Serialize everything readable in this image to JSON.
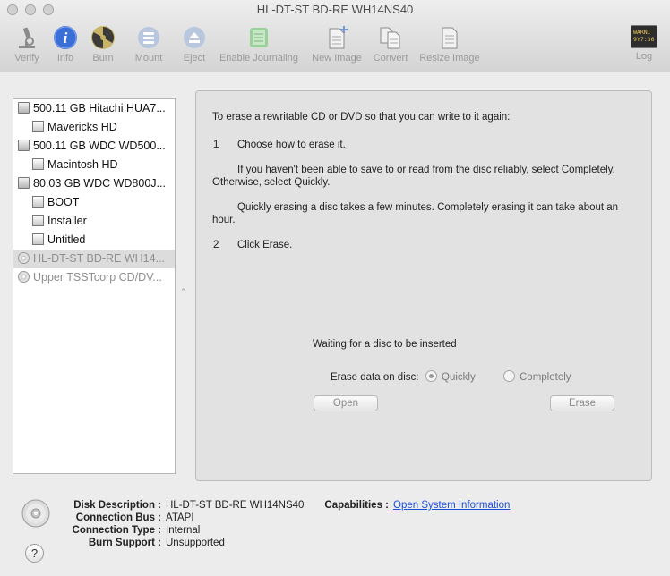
{
  "window": {
    "title": "HL-DT-ST BD-RE WH14NS40"
  },
  "toolbar": {
    "verify": "Verify",
    "info": "Info",
    "burn": "Burn",
    "mount": "Mount",
    "eject": "Eject",
    "enable_journaling": "Enable Journaling",
    "new_image": "New Image",
    "convert": "Convert",
    "resize_image": "Resize Image",
    "log": "Log",
    "log_screen_text": "WARNI\n9Y7:36"
  },
  "sidebar": {
    "items": [
      {
        "label": "500.11 GB Hitachi HUA7..."
      },
      {
        "label": "Mavericks HD"
      },
      {
        "label": "500.11 GB WDC WD500..."
      },
      {
        "label": "Macintosh HD"
      },
      {
        "label": "80.03 GB WDC WD800J..."
      },
      {
        "label": "BOOT"
      },
      {
        "label": "Installer"
      },
      {
        "label": "Untitled"
      },
      {
        "label": "HL-DT-ST BD-RE WH14..."
      },
      {
        "label": "Upper TSSTcorp CD/DV..."
      }
    ],
    "resize_glyph": "‸"
  },
  "erase": {
    "intro": "To erase a rewritable CD or DVD so that you can write to it again:",
    "step1_num": "1",
    "step1": "Choose how to erase it.",
    "para1": "If you haven't been able to save to or read from the disc reliably, select Completely. Otherwise, select Quickly.",
    "para2": "Quickly erasing a disc takes a few minutes. Completely erasing it can take about an hour.",
    "step2_num": "2",
    "step2": "Click Erase.",
    "status": "Waiting for a disc to be inserted",
    "erase_data_label": "Erase data on disc:",
    "option_quickly": "Quickly",
    "option_completely": "Completely",
    "open_button": "Open",
    "erase_button": "Erase"
  },
  "info": {
    "disk_description_label": "Disk Description :",
    "disk_description": "HL-DT-ST BD-RE WH14NS40",
    "connection_bus_label": "Connection Bus :",
    "connection_bus": "ATAPI",
    "connection_type_label": "Connection Type :",
    "connection_type": "Internal",
    "burn_support_label": "Burn Support :",
    "burn_support": "Unsupported",
    "capabilities_label": "Capabilities :",
    "capabilities_link": "Open System Information",
    "help": "?"
  },
  "colors": {
    "info_icon": "#3b6fd8",
    "link": "#1a4fd6",
    "window_bg": "#ececec"
  }
}
